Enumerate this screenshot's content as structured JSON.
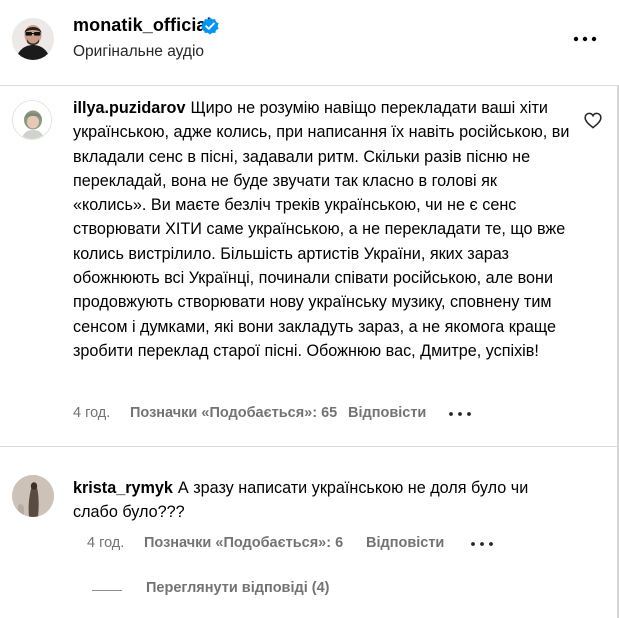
{
  "header": {
    "username": "monatik_official",
    "subtitle": "Оригінальне аудіо",
    "verified_icon": "verified-badge-icon",
    "more_icon": "more-options-icon"
  },
  "comments": [
    {
      "author": "illya.puzidarov",
      "text": "Щиро не розумію навіщо перекладати ваші хіти українською, адже колись, при написання їх навіть російською, ви вкладали сенс в пісні, задавали ритм. Скільки разів пісню не перекладай, вона не буде звучати так класно в голові як «колись». Ви маєте безліч треків українською, чи не є сенс створювати ХІТИ саме українською, а не перекладати те, що вже колись вистрілило. Більшість артистів України, яких зараз обожнюють всі Українці, починали співати російською, але вони продовжують створювати нову українську музику, сповнену тим сенсом і думками, які вони закладуть зараз, а не якомога краще зробити переклад старої пісні. Обожнюю вас, Дмитре, успіхів!",
      "time": "4 год.",
      "likes": "Позначки «Подобається»: 65",
      "reply": "Відповісти",
      "like_icon": "heart-icon"
    },
    {
      "author": "krista_rymyk",
      "text": "А зразу написати українською не доля було чи слабо було???",
      "time": "4 год.",
      "likes": "Позначки «Подобається»: 6",
      "reply": "Відповісти"
    }
  ],
  "view_replies": "Переглянути відповіді (4)",
  "colors": {
    "text": "#000000",
    "secondary": "#737373",
    "verified": "#0095f6",
    "divider": "#dbdbdb"
  }
}
